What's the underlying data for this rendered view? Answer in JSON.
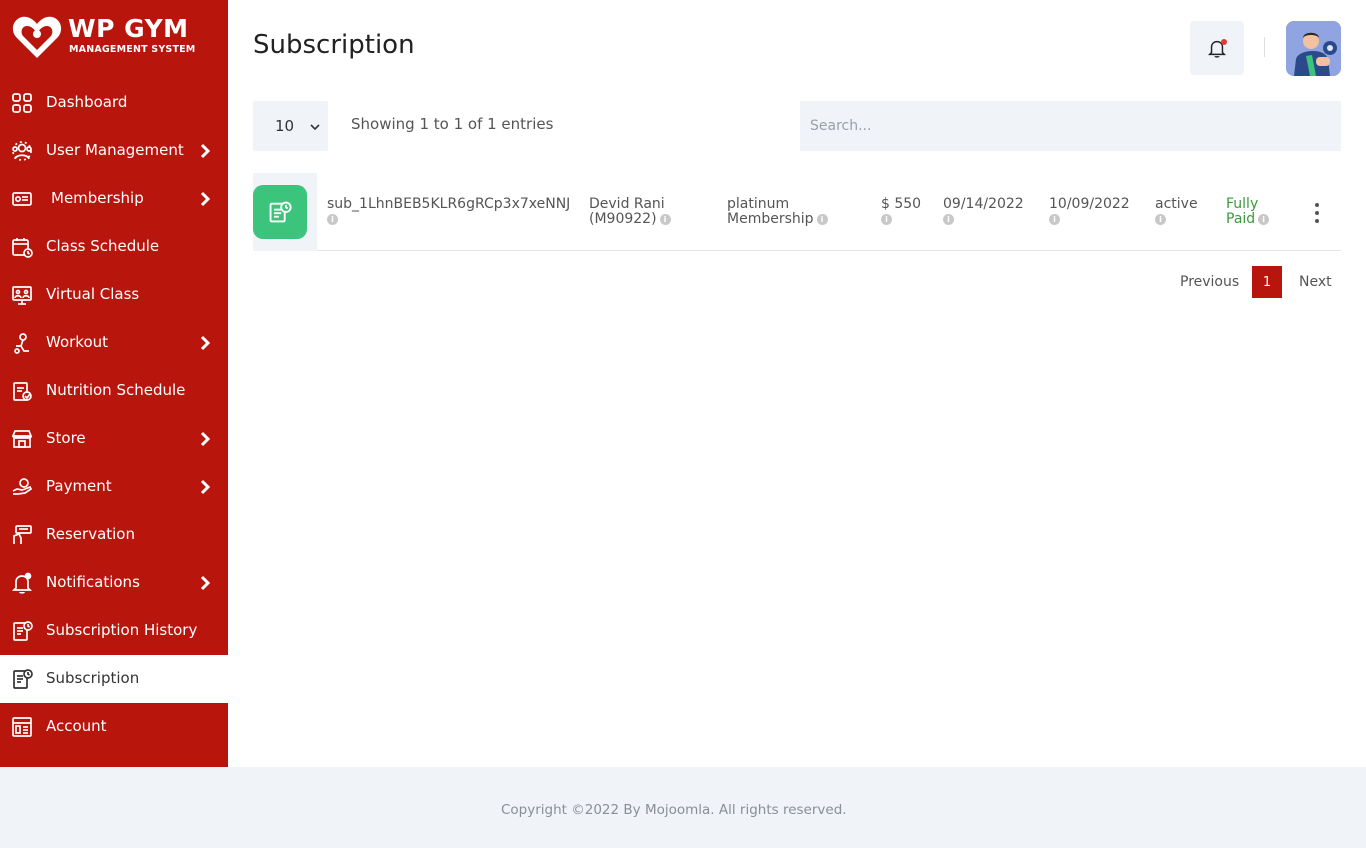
{
  "brand": {
    "title": "WP GYM",
    "subtitle": "MANAGEMENT SYSTEM"
  },
  "sidebar": {
    "items": [
      {
        "label": "Dashboard",
        "icon": "dashboard-icon",
        "has_submenu": false
      },
      {
        "label": "User Management",
        "icon": "users-icon",
        "has_submenu": true
      },
      {
        "label": "Membership",
        "icon": "membership-card-icon",
        "has_submenu": true
      },
      {
        "label": "Class Schedule",
        "icon": "calendar-icon",
        "has_submenu": false
      },
      {
        "label": "Virtual Class",
        "icon": "virtual-class-icon",
        "has_submenu": false
      },
      {
        "label": "Workout",
        "icon": "workout-icon",
        "has_submenu": true
      },
      {
        "label": "Nutrition Schedule",
        "icon": "nutrition-icon",
        "has_submenu": false
      },
      {
        "label": "Store",
        "icon": "store-icon",
        "has_submenu": true
      },
      {
        "label": "Payment",
        "icon": "payment-icon",
        "has_submenu": true
      },
      {
        "label": "Reservation",
        "icon": "reservation-icon",
        "has_submenu": false
      },
      {
        "label": "Notifications",
        "icon": "bell-icon",
        "has_submenu": true
      },
      {
        "label": "Subscription History",
        "icon": "subscription-history-icon",
        "has_submenu": false
      },
      {
        "label": "Subscription",
        "icon": "subscription-icon",
        "has_submenu": false,
        "active": true
      },
      {
        "label": "Account",
        "icon": "account-icon",
        "has_submenu": false
      }
    ]
  },
  "header": {
    "title": "Subscription",
    "notification_icon": "bell-icon",
    "has_unread": true
  },
  "controls": {
    "page_length": "10",
    "info": "Showing 1 to 1 of 1 entries",
    "search_placeholder": "Search..."
  },
  "table": {
    "rows": [
      {
        "subscription_id": "sub_1LhnBEB5KLR6gRCp3x7xeNNJ",
        "member_line1": "Devid Rani",
        "member_line2": "(M90922)",
        "membership_line1": "platinum",
        "membership_line2": "Membership",
        "amount": "$ 550",
        "start_date": "09/14/2022",
        "end_date": "10/09/2022",
        "status": "active",
        "payment_line1": "Fully",
        "payment_line2": "Paid"
      }
    ]
  },
  "pagination": {
    "previous": "Previous",
    "current": "1",
    "next": "Next"
  },
  "footer": {
    "text": "Copyright ©2022 By Mojoomla. All rights reserved."
  },
  "colors": {
    "brand_red": "#b8150d",
    "row_icon_green": "#3cc47c",
    "paid_green": "#3a9a3a",
    "light_bg": "#f0f3f8"
  }
}
